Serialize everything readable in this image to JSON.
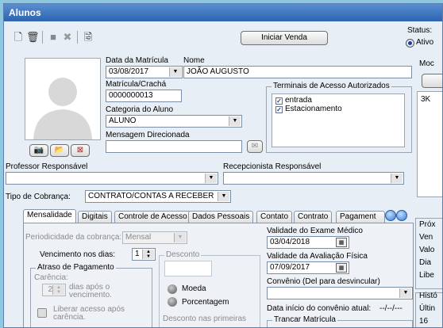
{
  "window": {
    "title": "Alunos"
  },
  "toolbar": {
    "icons": [
      "new-icon",
      "trash-icon",
      "save-icon",
      "cancel-icon",
      "print-icon"
    ],
    "start_sale": "Iniciar Venda"
  },
  "status": {
    "label": "Status:",
    "ativo": "Ativo"
  },
  "student": {
    "data_matricula_label": "Data da Matrícula",
    "data_matricula": "03/08/2017",
    "nome_label": "Nome",
    "nome": "JOÃO AUGUSTO",
    "matricula_label": "Matrícula/Crachá",
    "matricula": "0000000013",
    "categoria_label": "Categoria do Aluno",
    "categoria": "ALUNO",
    "mensagem_label": "Mensagem Direcionada",
    "mensagem": ""
  },
  "terminais": {
    "title": "Terminais de Acesso Autorizados",
    "items": [
      "entrada",
      "Estacionamento"
    ]
  },
  "right_panel": {
    "label_top": "Moc",
    "text": "3K"
  },
  "professor_label": "Professor Responsável",
  "recepcionista_label": "Recepcionista Responsável",
  "cobranca": {
    "label": "Tipo de Cobrança:",
    "value": "CONTRATO/CONTAS A RECEBER"
  },
  "tabs": [
    "Mensalidade",
    "Digitais",
    "Controle de Acesso",
    "Dados Pessoais",
    "Contato",
    "Contrato",
    "Pagament"
  ],
  "mensalidade": {
    "periodicidade_label": "Periodicidade da cobrança:",
    "periodicidade": "Mensal",
    "vencimento_label": "Vencimento nos dias:",
    "vencimento": "1",
    "atraso_title": "Atraso de Pagamento",
    "carencia_label": "Carência:",
    "carencia_value": "2",
    "dias_apos": "dias após o",
    "vencimento_text": "vencimento.",
    "liberar": "Liberar acesso após",
    "carencia_text": "carência.",
    "desconto_title": "Desconto",
    "moeda": "Moeda",
    "porcentagem": "Porcentagem",
    "desconto_primeiras": "Desconto nas primeiras"
  },
  "validade": {
    "exame_label": "Validade do Exame Médico",
    "exame": "03/04/2018",
    "avaliacao_label": "Validade da Avaliação Física",
    "avaliacao": "07/09/2017",
    "convenio_label": "Convênio (Del para desvincular)",
    "convenio": "",
    "inicio_label": "Data início do convênio atual:",
    "inicio_value": "--/--/---",
    "trancar": "Trancar Matrícula"
  },
  "right_side": {
    "items": [
      "Próx",
      "Ven",
      "Valo",
      "Dia",
      "Libe",
      "Histó",
      "Últin",
      "16"
    ]
  }
}
